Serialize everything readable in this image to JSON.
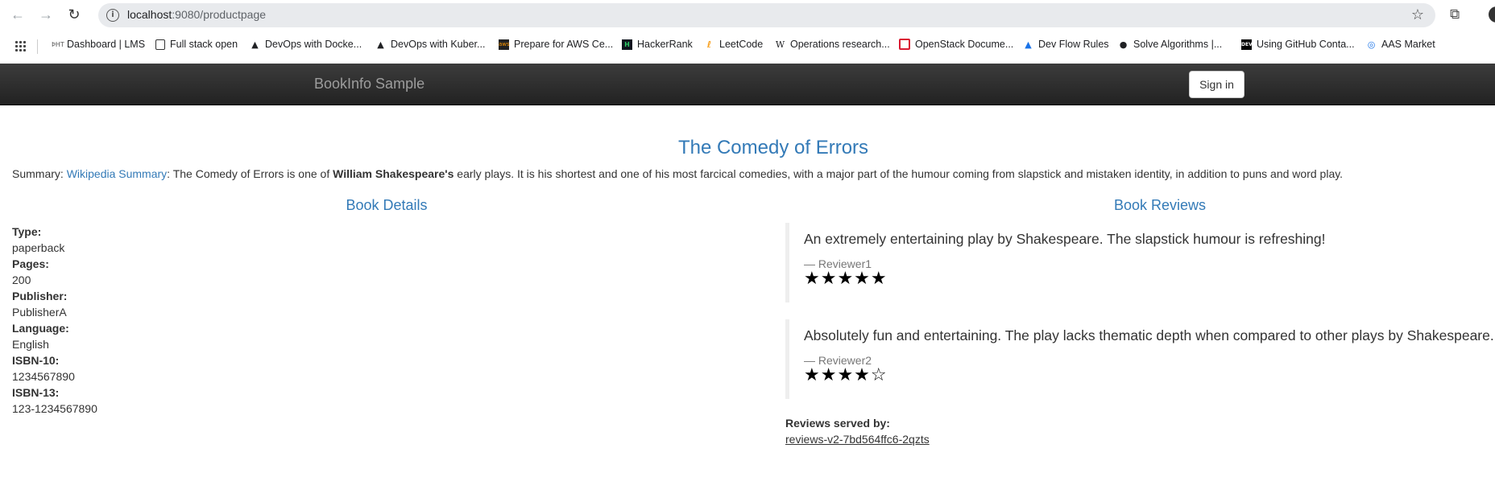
{
  "browser": {
    "url_host": "localhost",
    "url_rest": ":9080/productpage",
    "bookmarks": [
      {
        "label": "Dashboard | LMS",
        "icon": "lms-icon"
      },
      {
        "label": "Full stack open",
        "icon": "page-icon"
      },
      {
        "label": "DevOps with Docke...",
        "icon": "triangle-icon"
      },
      {
        "label": "DevOps with Kuber...",
        "icon": "triangle-icon"
      },
      {
        "label": "Prepare for AWS Ce...",
        "icon": "aws-icon"
      },
      {
        "label": "HackerRank",
        "icon": "hackerrank-icon"
      },
      {
        "label": "LeetCode",
        "icon": "leetcode-icon"
      },
      {
        "label": "Operations research...",
        "icon": "wikipedia-icon"
      },
      {
        "label": "OpenStack Docume...",
        "icon": "openstack-icon"
      },
      {
        "label": "Dev Flow Rules",
        "icon": "devflow-icon"
      },
      {
        "label": "Solve Algorithms |...",
        "icon": "globe-icon"
      },
      {
        "label": "Using GitHub Conta...",
        "icon": "dev-icon"
      },
      {
        "label": "AAS Market",
        "icon": "aas-icon"
      }
    ]
  },
  "navbar": {
    "brand": "BookInfo Sample",
    "signin": "Sign in"
  },
  "book": {
    "title": "The Comedy of Errors",
    "summary_label": "Summary: ",
    "summary_link": "Wikipedia Summary",
    "summary_pre": ": The Comedy of Errors is one of ",
    "summary_bold": "William Shakespeare's",
    "summary_post": " early plays. It is his shortest and one of his most farcical comedies, with a major part of the humour coming from slapstick and mistaken identity, in addition to puns and word play."
  },
  "details": {
    "heading": "Book Details",
    "items": [
      {
        "label": "Type:",
        "value": "paperback"
      },
      {
        "label": "Pages:",
        "value": "200"
      },
      {
        "label": "Publisher:",
        "value": "PublisherA"
      },
      {
        "label": "Language:",
        "value": "English"
      },
      {
        "label": "ISBN-10:",
        "value": "1234567890"
      },
      {
        "label": "ISBN-13:",
        "value": "123-1234567890"
      }
    ]
  },
  "reviews": {
    "heading": "Book Reviews",
    "items": [
      {
        "text": "An extremely entertaining play by Shakespeare. The slapstick humour is refreshing!",
        "reviewer": "— Reviewer1",
        "stars": "★★★★★",
        "rating": 5
      },
      {
        "text": "Absolutely fun and entertaining. The play lacks thematic depth when compared to other plays by Shakespeare.",
        "reviewer": "— Reviewer2",
        "stars": "★★★★☆",
        "rating": 4
      }
    ],
    "served_label": "Reviews served by:",
    "served_pod": "reviews-v2-7bd564ffc6-2qzts"
  }
}
